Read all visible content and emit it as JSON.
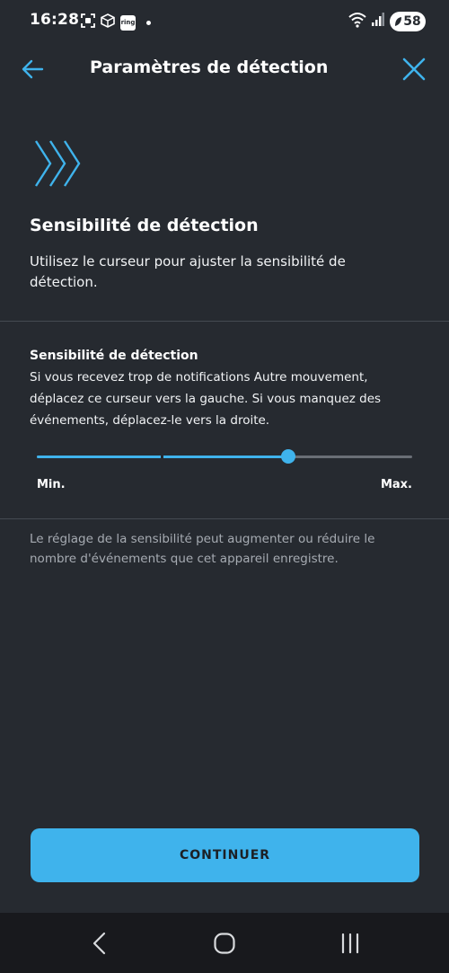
{
  "status_bar": {
    "time": "16:28",
    "left_icons": [
      "screenshot-icon",
      "package-icon",
      "ring-app-icon",
      "notification-dot-icon"
    ],
    "ring_label": "ring",
    "battery_level": "58",
    "right_icons": [
      "wifi-icon",
      "signal-icon",
      "battery-icon"
    ]
  },
  "header": {
    "title": "Paramètres de détection",
    "back_icon": "arrow-left-icon",
    "close_icon": "close-icon"
  },
  "colors": {
    "background": "#262a30",
    "accent": "#3fb3ec",
    "divider": "#444a52",
    "muted_text": "#a6abb2"
  },
  "intro": {
    "icon": "chevrons-right-icon",
    "title": "Sensibilité de détection",
    "description": "Utilisez le curseur pour ajuster la sensibilité de détection."
  },
  "sensitivity": {
    "label": "Sensibilité de détection",
    "description": "Si vous recevez trop de notifications Autre mouvement, déplacez ce curseur vers la gauche. Si vous manquez des événements, déplacez-le vers la droite.",
    "min_label": "Min.",
    "max_label": "Max.",
    "value_fraction": 0.67,
    "steps": 3
  },
  "footnote": "Le réglage de la sensibilité peut augmenter ou réduire le nombre d'événements que cet appareil enregistre.",
  "continue_button": "CONTINUER",
  "nav_bar": {
    "items": [
      "nav-back-icon",
      "nav-home-icon",
      "nav-recents-icon"
    ]
  }
}
